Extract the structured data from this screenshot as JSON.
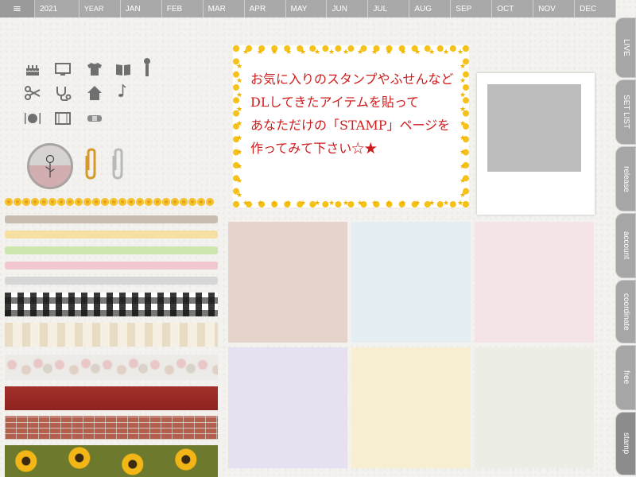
{
  "header": {
    "menu_icon": "≡",
    "year": "2021",
    "year_label": "YEAR",
    "months": [
      "JAN",
      "FEB",
      "MAR",
      "APR",
      "MAY",
      "JUN",
      "JUL",
      "AUG",
      "SEP",
      "OCT",
      "NOV",
      "DEC"
    ]
  },
  "tabs": [
    {
      "label": "LIVE"
    },
    {
      "label": "SET LIST"
    },
    {
      "label": "release"
    },
    {
      "label": "account"
    },
    {
      "label": "coordinate"
    },
    {
      "label": "free"
    },
    {
      "label": "stamp"
    }
  ],
  "note": {
    "text": "お気に入りのスタンプやふせんなど\nDLしてきたアイテムを貼って\nあなただけの「STAMP」ページを\n作ってみて下さい☆★"
  },
  "stickers": {
    "icons": [
      "cake-icon",
      "monitor-icon",
      "tshirt-icon",
      "book-icon",
      "microphone-icon",
      "scissors-icon",
      "stethoscope-icon",
      "home-icon",
      "music-note-icon",
      "dining-icon",
      "film-icon",
      "bandage-icon"
    ],
    "extras": [
      "rose-badge",
      "gold-paperclip-icon",
      "silver-paperclip-icon"
    ]
  },
  "tapes": {
    "stripes": [
      "#c8bcb0",
      "#f5dfa3",
      "#cde6ad",
      "#f1c8cf",
      "#d6d6d6"
    ],
    "patterns": [
      "gingham",
      "kraft-stripe",
      "floral",
      "red-leather",
      "brick",
      "sunflower"
    ]
  },
  "swatches": [
    "#e6d3cc",
    "#e5eef2",
    "#f5e4e6",
    "#e6e0f0",
    "#f8efd3",
    "#eceee6"
  ],
  "colors": {
    "tab": "#a6a6a6",
    "note_text": "#d01b1b",
    "note_border": "#f4c21a"
  }
}
